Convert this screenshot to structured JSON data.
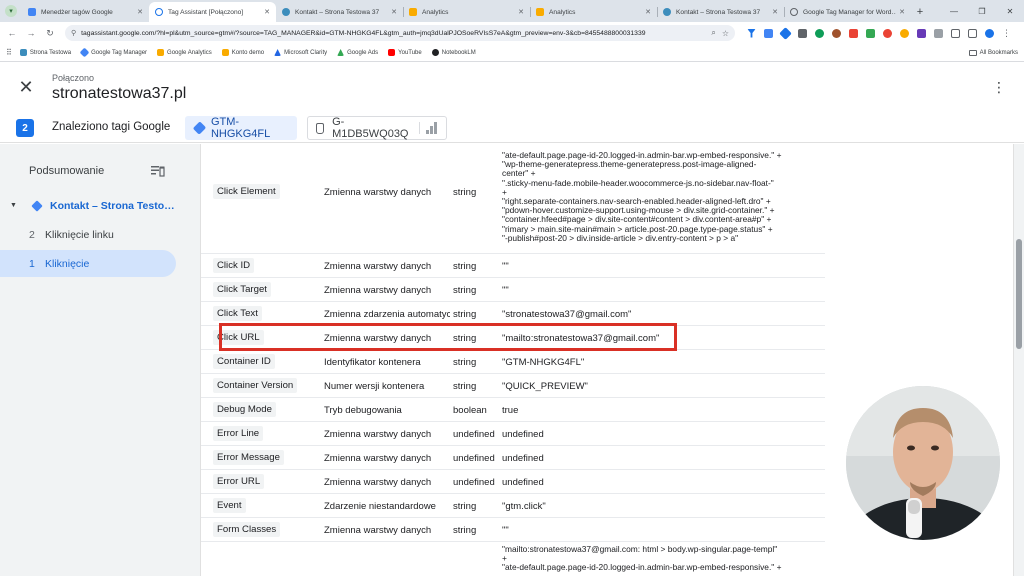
{
  "browser": {
    "tabs": [
      {
        "label": "Menedżer tagów Google",
        "active": false,
        "color": "#4285f4"
      },
      {
        "label": "Tag Assistant [Połączono]",
        "active": true,
        "color": "#1a73e8"
      },
      {
        "label": "Kontakt – Strona Testowa 37",
        "active": false,
        "color": "#3c8dbc"
      },
      {
        "label": "Analytics",
        "active": false,
        "color": "#f9ab00"
      },
      {
        "label": "Analytics",
        "active": false,
        "color": "#f9ab00"
      },
      {
        "label": "Kontakt – Strona Testowa 37",
        "active": false,
        "color": "#3c8dbc"
      },
      {
        "label": "Google Tag Manager for Word…",
        "active": false,
        "color": "#5f6368"
      }
    ],
    "url": "tagassistant.google.com/?hl=pl&utm_source=gtm#/?source=TAG_MANAGER&id=GTM-NHGKG4FL&gtm_auth=jmq3dUalPJOSoeRVIsS7eA&gtm_preview=env-3&cb=8455488800031339",
    "bookmarks": [
      {
        "label": "Strona Testowa",
        "color": "#3c8dbc"
      },
      {
        "label": "Google Tag Manager",
        "color": "#4285f4"
      },
      {
        "label": "Google Analytics",
        "color": "#f9ab00"
      },
      {
        "label": "Konto demo",
        "color": "#f9ab00"
      },
      {
        "label": "Microsoft Clarity",
        "color": "#2266e3"
      },
      {
        "label": "Google Ads",
        "color": "#34a853"
      },
      {
        "label": "YouTube",
        "color": "#ff0000"
      },
      {
        "label": "NotebookLM",
        "color": "#202124"
      }
    ],
    "all_bookmarks": "All Bookmarks"
  },
  "app": {
    "status": "Połączono",
    "site": "stronatestowa37.pl",
    "tag_count": "2",
    "found_label": "Znaleziono tagi Google",
    "container_chip": "GTM-NHGKG4FL",
    "ga_chip": "G-M1DB5WQ03Q"
  },
  "sidebar": {
    "title": "Podsumowanie",
    "page": "Kontakt – Strona Testo…",
    "events": [
      {
        "num": "2",
        "label": "Kliknięcie linku"
      },
      {
        "num": "1",
        "label": "Kliknięcie"
      }
    ]
  },
  "table": {
    "top_fragment": "\"ate-default.page.page-id-20.logged-in.admin-bar.wp-embed-responsive.\" +\n\"wp-theme-generatepress.theme-generatepress.post-image-aligned-\ncenter\" +\n\".sticky-menu-fade.mobile-header.woocommerce-js.no-sidebar.nav-float-\"\n+\n\"right.separate-containers.nav-search-enabled.header-aligned-left.dro\" +\n\"pdown-hover.customize-support.using-mouse > div.site.grid-container.\" +\n\"container.hfeed#page > div.site-content#content > div.content-area#p\" +\n\"rimary > main.site-main#main > article.post-20.page.type-page.status\" +\n\"-publish#post-20 > div.inside-article > div.entry-content > p > a\"",
    "rows": [
      {
        "key": "Click Element",
        "category": "Zmienna warstwy danych",
        "type": "string"
      },
      {
        "key": "Click ID",
        "category": "Zmienna warstwy danych",
        "type": "string",
        "value": "\"\""
      },
      {
        "key": "Click Target",
        "category": "Zmienna warstwy danych",
        "type": "string",
        "value": "\"\""
      },
      {
        "key": "Click Text",
        "category": "Zmienna zdarzenia automatyc",
        "type": "string",
        "value": "\"stronatestowa37@gmail.com\""
      },
      {
        "key": "Click URL",
        "category": "Zmienna warstwy danych",
        "type": "string",
        "value": "\"mailto:stronatestowa37@gmail.com\""
      },
      {
        "key": "Container ID",
        "category": "Identyfikator kontenera",
        "type": "string",
        "value": "\"GTM-NHGKG4FL\""
      },
      {
        "key": "Container Version",
        "category": "Numer wersji kontenera",
        "type": "string",
        "value": "\"QUICK_PREVIEW\""
      },
      {
        "key": "Debug Mode",
        "category": "Tryb debugowania",
        "type": "boolean",
        "value": "true"
      },
      {
        "key": "Error Line",
        "category": "Zmienna warstwy danych",
        "type": "undefined",
        "value": "undefined"
      },
      {
        "key": "Error Message",
        "category": "Zmienna warstwy danych",
        "type": "undefined",
        "value": "undefined"
      },
      {
        "key": "Error URL",
        "category": "Zmienna warstwy danych",
        "type": "undefined",
        "value": "undefined"
      },
      {
        "key": "Event",
        "category": "Zdarzenie niestandardowe",
        "type": "string",
        "value": "\"gtm.click\""
      },
      {
        "key": "Form Classes",
        "category": "Zmienna warstwy danych",
        "type": "string",
        "value": "\"\""
      }
    ],
    "bottom_fragment": "\"mailto:stronatestowa37@gmail.com: html > body.wp-singular.page-templ\"\n+\n\"ate-default.page.page-id-20.logged-in.admin-bar.wp-embed-responsive.\" +"
  }
}
